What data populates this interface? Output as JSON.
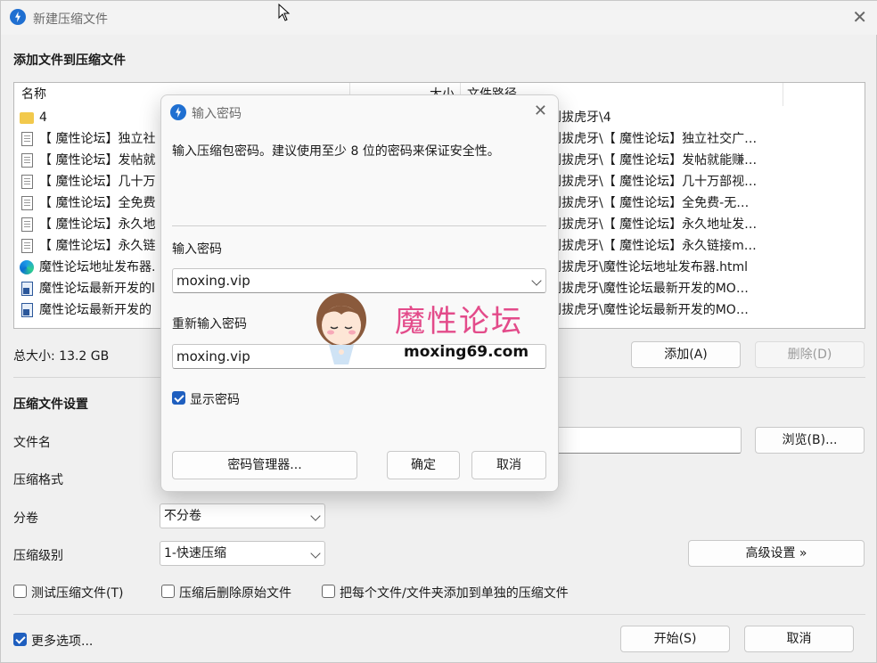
{
  "window": {
    "title": "新建压缩文件"
  },
  "add_section": {
    "title": "添加文件到压缩文件"
  },
  "file_list": {
    "columns": [
      "名称",
      "大小",
      "文件路径"
    ],
    "rows": [
      {
        "icon": "folder-icon",
        "name": "4",
        "path": "别拔虎牙\\4"
      },
      {
        "icon": "document-icon",
        "name": "【 魔性论坛】独立社",
        "path": "别拔虎牙\\【 魔性论坛】独立社交广…"
      },
      {
        "icon": "document-icon",
        "name": "【 魔性论坛】发帖就",
        "path": "别拔虎牙\\【 魔性论坛】发帖就能赚…"
      },
      {
        "icon": "document-icon",
        "name": "【 魔性论坛】几十万",
        "path": "别拔虎牙\\【 魔性论坛】几十万部视…"
      },
      {
        "icon": "document-icon",
        "name": "【 魔性论坛】全免费",
        "path": "别拔虎牙\\【 魔性论坛】全免费-无…"
      },
      {
        "icon": "document-icon",
        "name": "【 魔性论坛】永久地",
        "path": "别拔虎牙\\【 魔性论坛】永久地址发…"
      },
      {
        "icon": "document-icon",
        "name": "【 魔性论坛】永久链",
        "path": "别拔虎牙\\【 魔性论坛】永久链接m…"
      },
      {
        "icon": "edge-icon",
        "name": "魔性论坛地址发布器.",
        "path": "别拔虎牙\\魔性论坛地址发布器.html"
      },
      {
        "icon": "word-icon",
        "name": "魔性论坛最新开发的l",
        "path": "别拔虎牙\\魔性论坛最新开发的MO…"
      },
      {
        "icon": "word-icon",
        "name": "魔性论坛最新开发的",
        "path": "别拔虎牙\\魔性论坛最新开发的MO…"
      }
    ]
  },
  "total_size": "总大小: 13.2 GB",
  "buttons": {
    "add": "添加(A)",
    "delete": "删除(D)",
    "browse": "浏览(B)...",
    "advanced": "高级设置 »",
    "start": "开始(S)",
    "cancel": "取消"
  },
  "settings": {
    "title": "压缩文件设置",
    "filename_label": "文件名",
    "format_label": "压缩格式",
    "split_label": "分卷",
    "split_value": "不分卷",
    "level_label": "压缩级别",
    "level_value": "1-快速压缩",
    "opt_test": "测试压缩文件(T)",
    "opt_delete": "压缩后删除原始文件",
    "opt_each": "把每个文件/文件夹添加到单独的压缩文件",
    "more_options": "更多选项..."
  },
  "dialog": {
    "title": "输入密码",
    "description": "输入压缩包密码。建议使用至少 8 位的密码来保证安全性。",
    "password_label": "输入密码",
    "password_value": "moxing.vip",
    "reenter_label": "重新输入密码",
    "reenter_value": "moxing.vip",
    "show_password": "显示密码",
    "manager_button": "密码管理器...",
    "ok_button": "确定",
    "cancel_button": "取消"
  },
  "watermark": {
    "text": "魔性论坛",
    "url": "moxing69.com"
  },
  "colors": {
    "accent": "#1f5fbf",
    "watermark": "#e34b8a"
  }
}
